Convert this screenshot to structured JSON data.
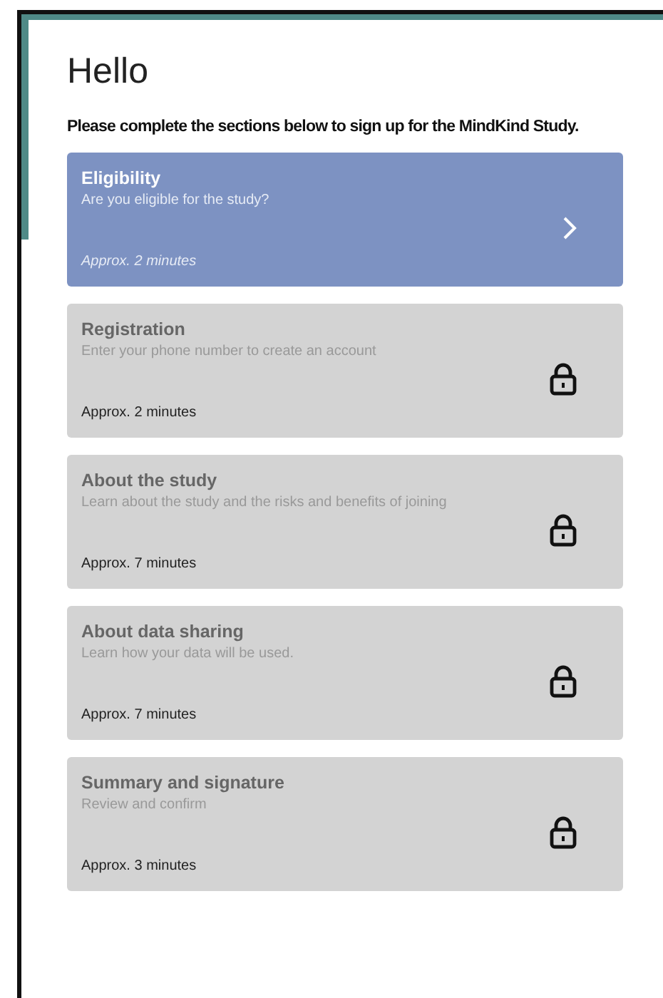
{
  "heading": "Hello",
  "intro": "Please complete the sections below to sign up for the MindKind Study.",
  "sections": [
    {
      "title": "Eligibility",
      "description": "Are you eligible for the study?",
      "duration": "Approx. 2 minutes",
      "locked": false
    },
    {
      "title": "Registration",
      "description": "Enter your phone number to create an account",
      "duration": "Approx. 2 minutes",
      "locked": true
    },
    {
      "title": "About the study",
      "description": "Learn about the study and the risks and benefits of joining",
      "duration": "Approx. 7 minutes",
      "locked": true
    },
    {
      "title": "About data sharing",
      "description": "Learn how your data will be used.",
      "duration": "Approx. 7 minutes",
      "locked": true
    },
    {
      "title": "Summary and signature",
      "description": "Review and confirm",
      "duration": "Approx. 3 minutes",
      "locked": true
    }
  ]
}
